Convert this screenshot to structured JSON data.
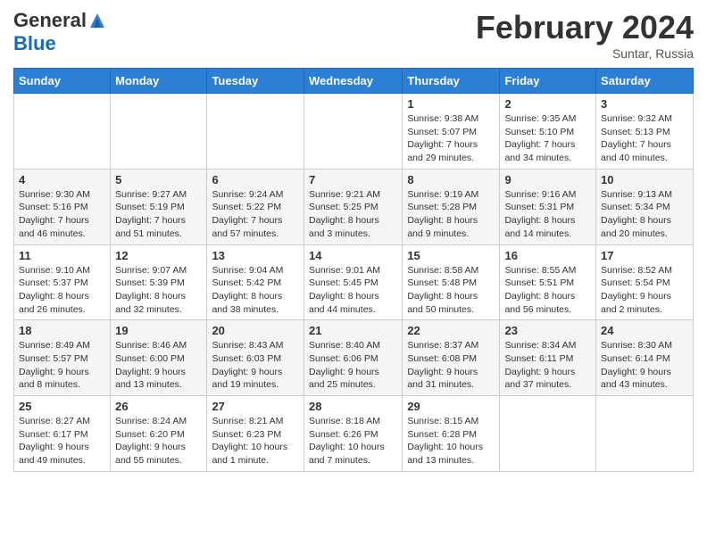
{
  "header": {
    "logo_general": "General",
    "logo_blue": "Blue",
    "month_title": "February 2024",
    "subtitle": "Suntar, Russia"
  },
  "days_of_week": [
    "Sunday",
    "Monday",
    "Tuesday",
    "Wednesday",
    "Thursday",
    "Friday",
    "Saturday"
  ],
  "weeks": [
    [
      {
        "day": "",
        "info": ""
      },
      {
        "day": "",
        "info": ""
      },
      {
        "day": "",
        "info": ""
      },
      {
        "day": "",
        "info": ""
      },
      {
        "day": "1",
        "info": "Sunrise: 9:38 AM\nSunset: 5:07 PM\nDaylight: 7 hours\nand 29 minutes."
      },
      {
        "day": "2",
        "info": "Sunrise: 9:35 AM\nSunset: 5:10 PM\nDaylight: 7 hours\nand 34 minutes."
      },
      {
        "day": "3",
        "info": "Sunrise: 9:32 AM\nSunset: 5:13 PM\nDaylight: 7 hours\nand 40 minutes."
      }
    ],
    [
      {
        "day": "4",
        "info": "Sunrise: 9:30 AM\nSunset: 5:16 PM\nDaylight: 7 hours\nand 46 minutes."
      },
      {
        "day": "5",
        "info": "Sunrise: 9:27 AM\nSunset: 5:19 PM\nDaylight: 7 hours\nand 51 minutes."
      },
      {
        "day": "6",
        "info": "Sunrise: 9:24 AM\nSunset: 5:22 PM\nDaylight: 7 hours\nand 57 minutes."
      },
      {
        "day": "7",
        "info": "Sunrise: 9:21 AM\nSunset: 5:25 PM\nDaylight: 8 hours\nand 3 minutes."
      },
      {
        "day": "8",
        "info": "Sunrise: 9:19 AM\nSunset: 5:28 PM\nDaylight: 8 hours\nand 9 minutes."
      },
      {
        "day": "9",
        "info": "Sunrise: 9:16 AM\nSunset: 5:31 PM\nDaylight: 8 hours\nand 14 minutes."
      },
      {
        "day": "10",
        "info": "Sunrise: 9:13 AM\nSunset: 5:34 PM\nDaylight: 8 hours\nand 20 minutes."
      }
    ],
    [
      {
        "day": "11",
        "info": "Sunrise: 9:10 AM\nSunset: 5:37 PM\nDaylight: 8 hours\nand 26 minutes."
      },
      {
        "day": "12",
        "info": "Sunrise: 9:07 AM\nSunset: 5:39 PM\nDaylight: 8 hours\nand 32 minutes."
      },
      {
        "day": "13",
        "info": "Sunrise: 9:04 AM\nSunset: 5:42 PM\nDaylight: 8 hours\nand 38 minutes."
      },
      {
        "day": "14",
        "info": "Sunrise: 9:01 AM\nSunset: 5:45 PM\nDaylight: 8 hours\nand 44 minutes."
      },
      {
        "day": "15",
        "info": "Sunrise: 8:58 AM\nSunset: 5:48 PM\nDaylight: 8 hours\nand 50 minutes."
      },
      {
        "day": "16",
        "info": "Sunrise: 8:55 AM\nSunset: 5:51 PM\nDaylight: 8 hours\nand 56 minutes."
      },
      {
        "day": "17",
        "info": "Sunrise: 8:52 AM\nSunset: 5:54 PM\nDaylight: 9 hours\nand 2 minutes."
      }
    ],
    [
      {
        "day": "18",
        "info": "Sunrise: 8:49 AM\nSunset: 5:57 PM\nDaylight: 9 hours\nand 8 minutes."
      },
      {
        "day": "19",
        "info": "Sunrise: 8:46 AM\nSunset: 6:00 PM\nDaylight: 9 hours\nand 13 minutes."
      },
      {
        "day": "20",
        "info": "Sunrise: 8:43 AM\nSunset: 6:03 PM\nDaylight: 9 hours\nand 19 minutes."
      },
      {
        "day": "21",
        "info": "Sunrise: 8:40 AM\nSunset: 6:06 PM\nDaylight: 9 hours\nand 25 minutes."
      },
      {
        "day": "22",
        "info": "Sunrise: 8:37 AM\nSunset: 6:08 PM\nDaylight: 9 hours\nand 31 minutes."
      },
      {
        "day": "23",
        "info": "Sunrise: 8:34 AM\nSunset: 6:11 PM\nDaylight: 9 hours\nand 37 minutes."
      },
      {
        "day": "24",
        "info": "Sunrise: 8:30 AM\nSunset: 6:14 PM\nDaylight: 9 hours\nand 43 minutes."
      }
    ],
    [
      {
        "day": "25",
        "info": "Sunrise: 8:27 AM\nSunset: 6:17 PM\nDaylight: 9 hours\nand 49 minutes."
      },
      {
        "day": "26",
        "info": "Sunrise: 8:24 AM\nSunset: 6:20 PM\nDaylight: 9 hours\nand 55 minutes."
      },
      {
        "day": "27",
        "info": "Sunrise: 8:21 AM\nSunset: 6:23 PM\nDaylight: 10 hours\nand 1 minute."
      },
      {
        "day": "28",
        "info": "Sunrise: 8:18 AM\nSunset: 6:26 PM\nDaylight: 10 hours\nand 7 minutes."
      },
      {
        "day": "29",
        "info": "Sunrise: 8:15 AM\nSunset: 6:28 PM\nDaylight: 10 hours\nand 13 minutes."
      },
      {
        "day": "",
        "info": ""
      },
      {
        "day": "",
        "info": ""
      }
    ]
  ]
}
